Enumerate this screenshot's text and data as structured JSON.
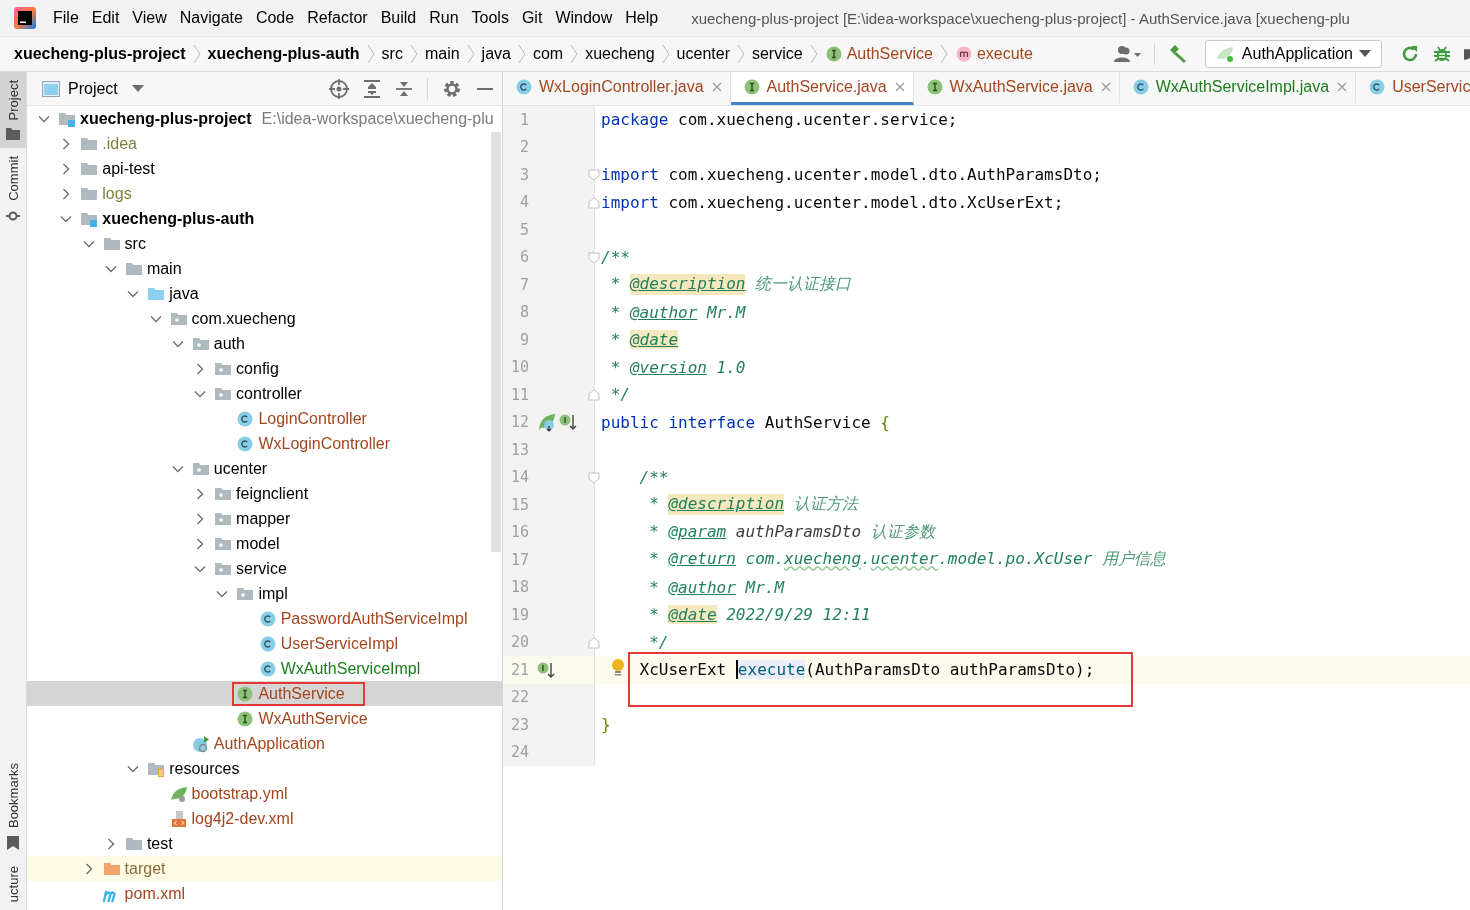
{
  "window": {
    "title": "xuecheng-plus-project [E:\\idea-workspace\\xuecheng-plus-project] - AuthService.java [xuecheng-plu"
  },
  "menu": [
    "File",
    "Edit",
    "View",
    "Navigate",
    "Code",
    "Refactor",
    "Build",
    "Run",
    "Tools",
    "Git",
    "Window",
    "Help"
  ],
  "breadcrumbs": [
    {
      "text": "xuecheng-plus-project",
      "bold": true,
      "kind": "text"
    },
    {
      "text": "xuecheng-plus-auth",
      "bold": true,
      "kind": "text"
    },
    {
      "text": "src",
      "bold": false,
      "kind": "text"
    },
    {
      "text": "main",
      "bold": false,
      "kind": "text"
    },
    {
      "text": "java",
      "bold": false,
      "kind": "text"
    },
    {
      "text": "com",
      "bold": false,
      "kind": "text"
    },
    {
      "text": "xuecheng",
      "bold": false,
      "kind": "text"
    },
    {
      "text": "ucenter",
      "bold": false,
      "kind": "text"
    },
    {
      "text": "service",
      "bold": false,
      "kind": "text"
    },
    {
      "text": "AuthService",
      "bold": false,
      "kind": "interface",
      "color": "#a3461e"
    },
    {
      "text": "execute",
      "bold": false,
      "kind": "method",
      "color": "#a3461e"
    }
  ],
  "run_configuration": {
    "label": "AuthApplication"
  },
  "tool_stripe_top": [
    {
      "label": "Project",
      "selected": true,
      "kind": "folder"
    },
    {
      "label": "Commit",
      "selected": false,
      "kind": "commit"
    }
  ],
  "tool_stripe_bottom": [
    {
      "label": "Bookmarks",
      "selected": false,
      "kind": "bookmark"
    },
    {
      "label": "ucture",
      "selected": false,
      "kind": "label"
    }
  ],
  "project_panel": {
    "title": "Project",
    "tree": [
      {
        "label": "xuecheng-plus-project",
        "kind": "module",
        "bold": true,
        "path": "E:\\idea-workspace\\xuecheng-plu",
        "color": "#000000",
        "expanded": true,
        "children": [
          {
            "label": ".idea",
            "kind": "folder",
            "color": "#7e7e3c",
            "expanded": false
          },
          {
            "label": "api-test",
            "kind": "folder",
            "color": "#000000",
            "expanded": false
          },
          {
            "label": "logs",
            "kind": "folder",
            "color": "#7e7e3c",
            "expanded": false
          },
          {
            "label": "xuecheng-plus-auth",
            "kind": "module",
            "bold": true,
            "color": "#000000",
            "expanded": true,
            "children": [
              {
                "label": "src",
                "kind": "folder",
                "color": "#000000",
                "expanded": true,
                "children": [
                  {
                    "label": "main",
                    "kind": "folder",
                    "color": "#000000",
                    "expanded": true,
                    "children": [
                      {
                        "label": "java",
                        "kind": "source",
                        "color": "#000000",
                        "expanded": true,
                        "children": [
                          {
                            "label": "com.xuecheng",
                            "kind": "package",
                            "color": "#000000",
                            "expanded": true,
                            "children": [
                              {
                                "label": "auth",
                                "kind": "package",
                                "color": "#000000",
                                "expanded": true,
                                "children": [
                                  {
                                    "label": "config",
                                    "kind": "package",
                                    "color": "#000000",
                                    "expanded": false
                                  },
                                  {
                                    "label": "controller",
                                    "kind": "package",
                                    "color": "#000000",
                                    "expanded": true,
                                    "children": [
                                      {
                                        "label": "LoginController",
                                        "kind": "class",
                                        "color": "#a3461e"
                                      },
                                      {
                                        "label": "WxLoginController",
                                        "kind": "class",
                                        "color": "#a3461e"
                                      }
                                    ]
                                  }
                                ]
                              },
                              {
                                "label": "ucenter",
                                "kind": "package",
                                "color": "#000000",
                                "expanded": true,
                                "children": [
                                  {
                                    "label": "feignclient",
                                    "kind": "package",
                                    "color": "#000000",
                                    "expanded": false
                                  },
                                  {
                                    "label": "mapper",
                                    "kind": "package",
                                    "color": "#000000",
                                    "expanded": false
                                  },
                                  {
                                    "label": "model",
                                    "kind": "package",
                                    "color": "#000000",
                                    "expanded": false
                                  },
                                  {
                                    "label": "service",
                                    "kind": "package",
                                    "color": "#000000",
                                    "expanded": true,
                                    "children": [
                                      {
                                        "label": "impl",
                                        "kind": "package",
                                        "color": "#000000",
                                        "expanded": true,
                                        "children": [
                                          {
                                            "label": "PasswordAuthServiceImpl",
                                            "kind": "class",
                                            "color": "#a3461e"
                                          },
                                          {
                                            "label": "UserServiceImpl",
                                            "kind": "class",
                                            "color": "#a3461e"
                                          },
                                          {
                                            "label": "WxAuthServiceImpl",
                                            "kind": "class",
                                            "color": "#1b7d1b"
                                          }
                                        ]
                                      },
                                      {
                                        "label": "AuthService",
                                        "kind": "interface",
                                        "color": "#a3461e",
                                        "selected": true,
                                        "marked": true
                                      },
                                      {
                                        "label": "WxAuthService",
                                        "kind": "interface",
                                        "color": "#a3461e"
                                      }
                                    ]
                                  }
                                ]
                              },
                              {
                                "label": "AuthApplication",
                                "kind": "app",
                                "color": "#a3461e"
                              }
                            ]
                          }
                        ]
                      },
                      {
                        "label": "resources",
                        "kind": "resources",
                        "color": "#000000",
                        "expanded": true,
                        "children": [
                          {
                            "label": "bootstrap.yml",
                            "kind": "yml",
                            "color": "#a3461e"
                          },
                          {
                            "label": "log4j2-dev.xml",
                            "kind": "xml",
                            "color": "#a3461e"
                          }
                        ]
                      }
                    ]
                  },
                  {
                    "label": "test",
                    "kind": "folder",
                    "color": "#000000",
                    "expanded": false
                  }
                ]
              },
              {
                "label": "target",
                "kind": "excluded",
                "color": "#8c6a3c",
                "expanded": false,
                "highlighted": true
              },
              {
                "label": "pom.xml",
                "kind": "maven",
                "color": "#a3461e"
              }
            ]
          }
        ]
      }
    ]
  },
  "editor_tabs": [
    {
      "label": "WxLoginController.java",
      "kind": "class",
      "color": "#a3461e",
      "selected": false,
      "closable": true
    },
    {
      "label": "AuthService.java",
      "kind": "interface",
      "color": "#a3461e",
      "selected": true,
      "closable": true
    },
    {
      "label": "WxAuthService.java",
      "kind": "interface",
      "color": "#a3461e",
      "selected": false,
      "closable": true
    },
    {
      "label": "WxAuthServiceImpl.java",
      "kind": "class",
      "color": "#1b7d1b",
      "selected": false,
      "closable": true
    },
    {
      "label": "UserServic",
      "kind": "class",
      "color": "#a3461e",
      "selected": false,
      "closable": false
    }
  ],
  "code_lines": [
    {
      "number": "1",
      "kind": "plain",
      "tokens": [
        {
          "t": "package",
          "kind": "kw"
        },
        {
          "t": " com.xuecheng.ucenter.service;",
          "kind": "plain"
        }
      ]
    },
    {
      "number": "2",
      "kind": "plain"
    },
    {
      "number": "3",
      "kind": "fold-start",
      "tokens": [
        {
          "t": "import",
          "kind": "kw"
        },
        {
          "t": " com.xuecheng.ucenter.model.dto.AuthParamsDto;",
          "kind": "plain"
        }
      ]
    },
    {
      "number": "4",
      "kind": "fold-end",
      "tokens": [
        {
          "t": "import",
          "kind": "kw"
        },
        {
          "t": " com.xuecheng.ucenter.model.dto.XcUserExt;",
          "kind": "plain"
        }
      ]
    },
    {
      "number": "5",
      "kind": "plain"
    },
    {
      "number": "6",
      "kind": "fold-start",
      "tokens": [
        {
          "t": "/**",
          "kind": "doc"
        }
      ]
    },
    {
      "number": "7",
      "kind": "plain",
      "tokens": [
        {
          "t": " * ",
          "kind": "doc"
        },
        {
          "t": "@description",
          "kind": "tag",
          "hl": true
        },
        {
          "t": " 统一认证接口",
          "kind": "doctext"
        }
      ]
    },
    {
      "number": "8",
      "kind": "plain",
      "tokens": [
        {
          "t": " * ",
          "kind": "doc"
        },
        {
          "t": "@author",
          "kind": "tag",
          "hl": false
        },
        {
          "t": " Mr.M",
          "kind": "doc"
        }
      ]
    },
    {
      "number": "9",
      "kind": "plain",
      "tokens": [
        {
          "t": " * ",
          "kind": "doc"
        },
        {
          "t": "@date",
          "kind": "tag",
          "hl": true
        }
      ]
    },
    {
      "number": "10",
      "kind": "plain",
      "tokens": [
        {
          "t": " * ",
          "kind": "doc"
        },
        {
          "t": "@version",
          "kind": "tag",
          "hl": false
        },
        {
          "t": " 1.0",
          "kind": "doc"
        }
      ]
    },
    {
      "number": "11",
      "kind": "fold-end",
      "tokens": [
        {
          "t": " */",
          "kind": "doc"
        }
      ]
    },
    {
      "number": "12",
      "kind": "implemented",
      "tokens": [
        {
          "t": "public",
          "kind": "kw"
        },
        {
          "t": " interface",
          "kind": "kw"
        },
        {
          "t": " AuthService ",
          "kind": "plain"
        },
        {
          "t": "{",
          "kind": "brace"
        }
      ]
    },
    {
      "number": "13",
      "kind": "plain"
    },
    {
      "number": "14",
      "kind": "fold-start",
      "tokens": [
        {
          "t": "    /**",
          "kind": "doc"
        }
      ]
    },
    {
      "number": "15",
      "kind": "plain",
      "tokens": [
        {
          "t": "     * ",
          "kind": "doc"
        },
        {
          "t": "@description",
          "kind": "tag",
          "hl": true
        },
        {
          "t": " 认证方法",
          "kind": "doctext"
        }
      ]
    },
    {
      "number": "16",
      "kind": "plain",
      "tokens": [
        {
          "t": "     * ",
          "kind": "doc"
        },
        {
          "t": "@param",
          "kind": "tag",
          "hl": false
        },
        {
          "t": " authParamsDto",
          "kind": "docref"
        },
        {
          "t": " 认证参数",
          "kind": "doctext"
        }
      ]
    },
    {
      "number": "17",
      "kind": "plain",
      "tokens": [
        {
          "t": "     * ",
          "kind": "doc"
        },
        {
          "t": "@return",
          "kind": "tag",
          "hl": false
        },
        {
          "t": " com.",
          "kind": "doc"
        },
        {
          "t": "xuecheng",
          "kind": "typo"
        },
        {
          "t": ".",
          "kind": "doc"
        },
        {
          "t": "ucenter",
          "kind": "typo"
        },
        {
          "t": ".model.po.XcUser",
          "kind": "doc"
        },
        {
          "t": " 用户信息",
          "kind": "doctext"
        }
      ]
    },
    {
      "number": "18",
      "kind": "plain",
      "tokens": [
        {
          "t": "     * ",
          "kind": "doc"
        },
        {
          "t": "@author",
          "kind": "tag",
          "hl": false
        },
        {
          "t": " Mr.M",
          "kind": "doc"
        }
      ]
    },
    {
      "number": "19",
      "kind": "plain",
      "tokens": [
        {
          "t": "     * ",
          "kind": "doc"
        },
        {
          "t": "@date",
          "kind": "tag",
          "hl": true
        },
        {
          "t": " 2022/9/29 12:11",
          "kind": "doc"
        }
      ]
    },
    {
      "number": "20",
      "kind": "fold-end",
      "tokens": [
        {
          "t": "     */",
          "kind": "doc"
        }
      ]
    },
    {
      "number": "21",
      "kind": "implementing",
      "current": true,
      "bulb": true,
      "marked": true,
      "tokens": [
        {
          "t": "    XcUserExt ",
          "kind": "plain"
        },
        {
          "t": "execute",
          "kind": "method",
          "caret": true
        },
        {
          "t": "(AuthParamsDto authParamsDto);",
          "kind": "plain"
        }
      ]
    },
    {
      "number": "22",
      "kind": "plain"
    },
    {
      "number": "23",
      "kind": "plain",
      "tokens": [
        {
          "t": "}",
          "kind": "brace"
        }
      ]
    },
    {
      "number": "24",
      "kind": "plain"
    }
  ]
}
